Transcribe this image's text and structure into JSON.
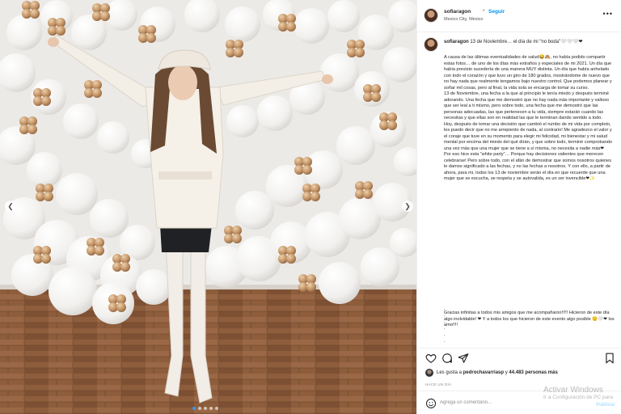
{
  "photo": {
    "alt": "Fotografía de Instagram",
    "prev_icon": "chevron-left-icon",
    "next_icon": "chevron-right-icon",
    "slide_count": 5,
    "active_slide": 1,
    "colors": {
      "balloon": "#f5f4f2",
      "gold": "#c89a6a",
      "floor": "#8a5a3a",
      "wall": "#ece9e6"
    }
  },
  "header": {
    "username": "sofiaragon",
    "separator": "•",
    "follow_label": "Seguir",
    "location": "Mexico City, Mexico",
    "more_icon": "ellipsis-icon",
    "more_label": "•••"
  },
  "caption": {
    "username": "sofiaragon",
    "title": "13 de Noviembre… el día de mi “no boda”🤍🤍🤍❤",
    "paragraphs": [
      "A causa de las últimas eventualidades de salud😂🙈, no había podido compartir estas fotos… de uno de los días más extraños y especiales de mi 2021. Un día que había previsto sucedería de una manera MUY distinta. Un día que había anhelado con todo el corazón y que tuvo un giro de 180 grados, mostrándome de nuevo que no hay nada que realmente tengamos bajo nuestro control. Que podemos planear y soñar mil cosas, pero al final, la vida sola se encarga de tomar su curso.",
      "13 de Noviembre, una fecha a la que al principio le tenía miedo y después terminé adorando. Una fecha que me demostró que no hay nada más importante y valioso que ser leal a ti mismo, pero sobre todo, una fecha que me demostró que las personas adecuadas, las que pertenecen a tu vida, siempre estarán cuando las necesitas y que ellas son en realidad las que le terminan dando sentido a todo.",
      "Hoy, después de tomar una decisión que cambió el rumbo de mi vida por completo, les puedo decir que no me arrepiento de nada, al contrario! Me agradezco el valor y el coraje que tuve en su momento para elegir mi felicidad, mi bienestar y mi salud mental por encima del miedo del qué dirán, y que sobre todo, terminé comprobando una vez más que una mujer que se tiene a sí misma, no necesita a nadie más❤",
      "Por eso hice esta “white party”… Porque hay decisiones valientes que merecen celebrarse! Pero sobre todo, con el afán de demostrar que somos nosotros quienes le damos significado a las fechas, y no las fechas a nosotros. Y con ello, a partir de ahora, para mi, todos los 13 de noviembre serán el día en que recuerde que una mujer que se escucha, se respeta y se autovalida, es un ser invencible❤✨"
    ],
    "dots": [
      ".",
      ".",
      ".",
      ".",
      ".",
      "."
    ],
    "tail": "Gracias infinitas a todos mis amigos que me acompañaron!!!!! Hicieron de este día algo inolvidable! ❤ Y a todos los que hicieron de este evento algo posible 😌🤍❤ los amo!!!!"
  },
  "actions": {
    "like_icon": "heart-icon",
    "comment_icon": "comment-icon",
    "share_icon": "send-icon",
    "save_icon": "bookmark-icon"
  },
  "likes": {
    "prefix": "Les gusta a",
    "user": "pedrochavarriasp",
    "connector": "y",
    "count": "44.483 personas más"
  },
  "time_ago": "HACE UN DÍA",
  "comment": {
    "emoji_icon": "smiley-icon",
    "placeholder": "Agrega un comentario…",
    "publish_label": "Publicar"
  },
  "watermark": {
    "title": "Activar Windows",
    "subtitle": "Ir a Configuración de PC para"
  }
}
